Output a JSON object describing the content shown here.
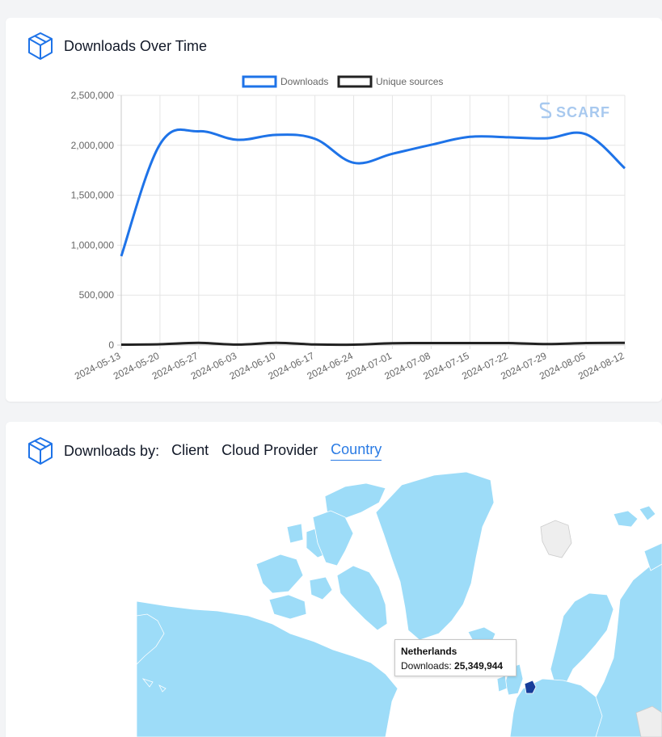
{
  "downloads_card": {
    "title": "Downloads Over Time",
    "watermark": "SCARF",
    "box_icon": "package-box-icon"
  },
  "colors": {
    "downloads": "#1e73e8",
    "unique_sources": "#222222",
    "map_land": "#9ddcf8",
    "map_highlight": "#173d9a",
    "active_tab": "#2a7be4",
    "watermark": "#a8c9ef"
  },
  "chart_data": {
    "type": "line",
    "x": [
      "2024-05-13",
      "2024-05-20",
      "2024-05-27",
      "2024-06-03",
      "2024-06-10",
      "2024-06-17",
      "2024-06-24",
      "2024-07-01",
      "2024-07-08",
      "2024-07-15",
      "2024-07-22",
      "2024-07-29",
      "2024-08-05",
      "2024-08-12"
    ],
    "series": [
      {
        "name": "Downloads",
        "values": [
          890000,
          2010000,
          2140000,
          2055000,
          2105000,
          2065000,
          1825000,
          1915000,
          2005000,
          2085000,
          2080000,
          2070000,
          2110000,
          1770000
        ]
      },
      {
        "name": "Unique sources",
        "values": [
          4000,
          8000,
          22000,
          5000,
          22000,
          6000,
          4000,
          18000,
          20000,
          20000,
          20000,
          10000,
          20000,
          22000
        ]
      }
    ],
    "ylim": [
      0,
      2500000
    ],
    "yticks": [
      "0",
      "500,000",
      "1,000,000",
      "1,500,000",
      "2,000,000",
      "2,500,000"
    ],
    "ytick_values": [
      0,
      500000,
      1000000,
      1500000,
      2000000,
      2500000
    ],
    "legend_position": "top-center",
    "grid": true
  },
  "country_card": {
    "label": "Downloads by:",
    "tabs": [
      {
        "label": "Client",
        "active": false
      },
      {
        "label": "Cloud Provider",
        "active": false
      },
      {
        "label": "Country",
        "active": true
      }
    ],
    "tooltip": {
      "country": "Netherlands",
      "metric_label": "Downloads:",
      "value": "25,349,944"
    }
  }
}
